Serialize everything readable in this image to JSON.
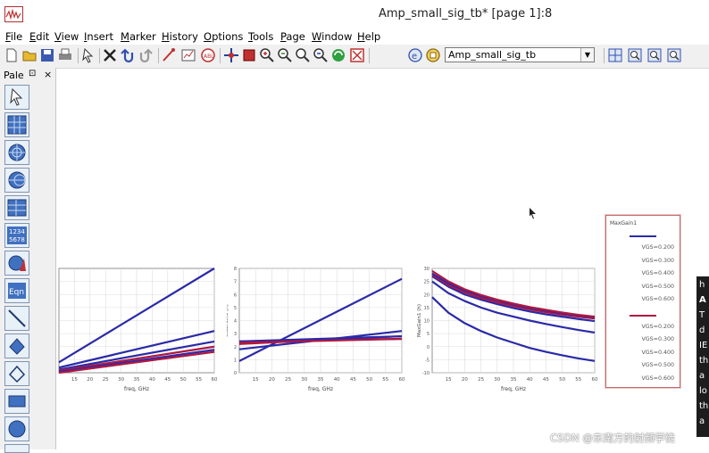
{
  "window": {
    "title": "Amp_small_sig_tb* [page 1]:8"
  },
  "menu": [
    {
      "label": "File",
      "u": "F"
    },
    {
      "label": "Edit",
      "u": "E"
    },
    {
      "label": "View",
      "u": "V"
    },
    {
      "label": "Insert",
      "u": "I"
    },
    {
      "label": "Marker",
      "u": "M"
    },
    {
      "label": "History",
      "u": "H"
    },
    {
      "label": "Options",
      "u": "O"
    },
    {
      "label": "Tools",
      "u": "T"
    },
    {
      "label": "Page",
      "u": "P"
    },
    {
      "label": "Window",
      "u": "W"
    },
    {
      "label": "Help",
      "u": "H"
    }
  ],
  "toolbar": {
    "dataset_value": "Amp_small_sig_tb"
  },
  "palette": {
    "title": "Pale",
    "pin": "⊡",
    "close": "×"
  },
  "legend": {
    "title": "MaxGain1",
    "groups": [
      {
        "color": "#2a2aa8",
        "labels": [
          "VGS=0.200",
          "VGS=0.300",
          "VGS=0.400",
          "VGS=0.500",
          "VGS=0.600"
        ]
      },
      {
        "color": "#b01840",
        "labels": [
          "VGS=0.200",
          "VGS=0.300",
          "VGS=0.400",
          "VGS=0.500",
          "VGS=0.600"
        ]
      }
    ]
  },
  "tooltip_fragments": [
    "h",
    "A",
    "T",
    "d",
    "IE",
    "th",
    "a",
    "lo",
    "th",
    "a"
  ],
  "watermark": "CSDN @东南方的射频学徒",
  "chart_data": [
    {
      "type": "line",
      "title": "",
      "xlabel": "freq, GHz",
      "ylabel": "",
      "xlim": [
        10,
        60
      ],
      "xticks": [
        15,
        20,
        25,
        30,
        35,
        40,
        45,
        50,
        55,
        60
      ],
      "yticks": [],
      "series": [
        {
          "color": "#2a2aa8",
          "x": [
            10,
            60
          ],
          "y": [
            0.1,
            1.0
          ]
        },
        {
          "color": "#2a2aa8",
          "x": [
            10,
            60
          ],
          "y": [
            0.05,
            0.4
          ]
        },
        {
          "color": "#2a2aa8",
          "x": [
            10,
            60
          ],
          "y": [
            0.03,
            0.3
          ]
        },
        {
          "color": "#b01840",
          "x": [
            10,
            60
          ],
          "y": [
            0.02,
            0.25
          ]
        },
        {
          "color": "#2a2aa8",
          "x": [
            10,
            60
          ],
          "y": [
            0.01,
            0.22
          ]
        },
        {
          "color": "#b01840",
          "x": [
            10,
            60
          ],
          "y": [
            0.0,
            0.2
          ]
        }
      ]
    },
    {
      "type": "line",
      "title": "",
      "xlabel": "freq, GHz",
      "ylabel": "StabFact1 (h)",
      "xlim": [
        10,
        60
      ],
      "ylim": [
        0,
        8
      ],
      "xticks": [
        15,
        20,
        25,
        30,
        35,
        40,
        45,
        50,
        55,
        60
      ],
      "yticks": [
        0,
        1,
        2,
        3,
        4,
        5,
        6,
        7,
        8
      ],
      "series": [
        {
          "color": "#2a2aa8",
          "x": [
            10,
            60
          ],
          "y": [
            0.9,
            7.2
          ]
        },
        {
          "color": "#2a2aa8",
          "x": [
            10,
            60
          ],
          "y": [
            1.8,
            3.2
          ]
        },
        {
          "color": "#b01840",
          "x": [
            10,
            60
          ],
          "y": [
            2.2,
            2.8
          ]
        },
        {
          "color": "#2a2aa8",
          "x": [
            10,
            60
          ],
          "y": [
            2.4,
            2.6
          ]
        },
        {
          "color": "#2a2aa8",
          "x": [
            10,
            60
          ],
          "y": [
            2.4,
            2.8
          ]
        },
        {
          "color": "#b01840",
          "x": [
            10,
            60
          ],
          "y": [
            2.3,
            2.6
          ]
        }
      ]
    },
    {
      "type": "line",
      "title": "",
      "xlabel": "freq, GHz",
      "ylabel": "MaxGain1 (h)",
      "xlim": [
        10,
        60
      ],
      "ylim": [
        -10,
        30
      ],
      "xticks": [
        15,
        20,
        25,
        30,
        35,
        40,
        45,
        50,
        55,
        60
      ],
      "yticks": [
        -10,
        -5,
        0,
        5,
        10,
        15,
        20,
        25,
        30
      ],
      "series": [
        {
          "color": "#2a2aa8",
          "x": [
            10,
            15,
            20,
            25,
            30,
            35,
            40,
            45,
            50,
            55,
            60
          ],
          "y": [
            19,
            13,
            9,
            6,
            3.5,
            1.5,
            -0.5,
            -2,
            -3.3,
            -4.5,
            -5.5
          ]
        },
        {
          "color": "#2a2aa8",
          "x": [
            10,
            15,
            20,
            25,
            30,
            35,
            40,
            45,
            50,
            55,
            60
          ],
          "y": [
            25,
            20.5,
            17.5,
            15,
            13,
            11.5,
            10,
            8.7,
            7.5,
            6.4,
            5.4
          ]
        },
        {
          "color": "#2a2aa8",
          "x": [
            10,
            15,
            20,
            25,
            30,
            35,
            40,
            45,
            50,
            55,
            60
          ],
          "y": [
            27,
            23,
            20,
            18,
            16.3,
            14.8,
            13.5,
            12.4,
            11.5,
            10.6,
            9.8
          ]
        },
        {
          "color": "#b01840",
          "x": [
            10,
            15,
            20,
            25,
            30,
            35,
            40,
            45,
            50,
            55,
            60
          ],
          "y": [
            27.5,
            23.6,
            20.8,
            18.7,
            17,
            15.6,
            14.3,
            13.2,
            12.3,
            11.5,
            10.8
          ]
        },
        {
          "color": "#2a2aa8",
          "x": [
            10,
            15,
            20,
            25,
            30,
            35,
            40,
            45,
            50,
            55,
            60
          ],
          "y": [
            28,
            24.3,
            21.5,
            19.4,
            17.7,
            16.2,
            14.9,
            13.8,
            12.8,
            12,
            11.3
          ]
        },
        {
          "color": "#b01840",
          "x": [
            10,
            15,
            20,
            25,
            30,
            35,
            40,
            45,
            50,
            55,
            60
          ],
          "y": [
            29,
            25,
            22,
            19.8,
            18,
            16.5,
            15.2,
            14.1,
            13.1,
            12.2,
            11.5
          ]
        }
      ]
    }
  ]
}
